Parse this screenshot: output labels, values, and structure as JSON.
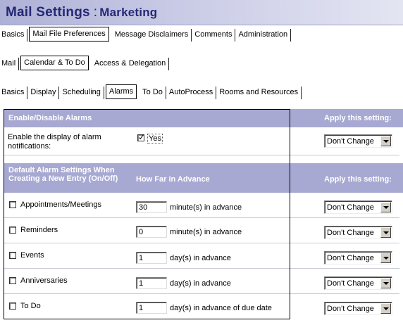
{
  "header": {
    "title": "Mail Settings",
    "separator": ":",
    "subtitle": "Marketing"
  },
  "tabs_main": [
    {
      "label": "Basics",
      "selected": false
    },
    {
      "label": "Mail File Preferences",
      "selected": true
    },
    {
      "label": "Message Disclaimers",
      "selected": false
    },
    {
      "label": "Comments",
      "selected": false
    },
    {
      "label": "Administration",
      "selected": false
    }
  ],
  "tabs_sub": [
    {
      "label": "Mail",
      "selected": false
    },
    {
      "label": "Calendar & To Do",
      "selected": true
    },
    {
      "label": "Access & Delegation",
      "selected": false
    }
  ],
  "tabs_cal": [
    {
      "label": "Basics",
      "selected": false
    },
    {
      "label": "Display",
      "selected": false
    },
    {
      "label": "Scheduling",
      "selected": false
    },
    {
      "label": "Alarms",
      "selected": true
    },
    {
      "label": "To Do",
      "selected": false
    },
    {
      "label": "AutoProcess",
      "selected": false
    },
    {
      "label": "Rooms and Resources",
      "selected": false
    }
  ],
  "section1": {
    "heading": "Enable/Disable Alarms",
    "apply_heading": "Apply this setting:",
    "enable_label": "Enable the display of alarm notifications:",
    "enable_checked": true,
    "enable_value_label": "Yes",
    "apply_value": "Don't Change"
  },
  "section2": {
    "heading": "Default Alarm Settings When Creating a New Entry (On/Off)",
    "advance_heading": "How Far in Advance",
    "apply_heading": "Apply this setting:",
    "rows": [
      {
        "label": "Appointments/Meetings",
        "checked": false,
        "value": "30",
        "unit": "minute(s) in advance",
        "apply": "Don't Change"
      },
      {
        "label": "Reminders",
        "checked": false,
        "value": "0",
        "unit": "minute(s) in advance",
        "apply": "Don't Change"
      },
      {
        "label": "Events",
        "checked": false,
        "value": "1",
        "unit": "day(s) in advance",
        "apply": "Don't Change"
      },
      {
        "label": "Anniversaries",
        "checked": false,
        "value": "1",
        "unit": "day(s) in advance",
        "apply": "Don't Change"
      },
      {
        "label": "To Do",
        "checked": false,
        "value": "1",
        "unit": "day(s) in advance of due date",
        "apply": "Don't Change"
      }
    ]
  }
}
